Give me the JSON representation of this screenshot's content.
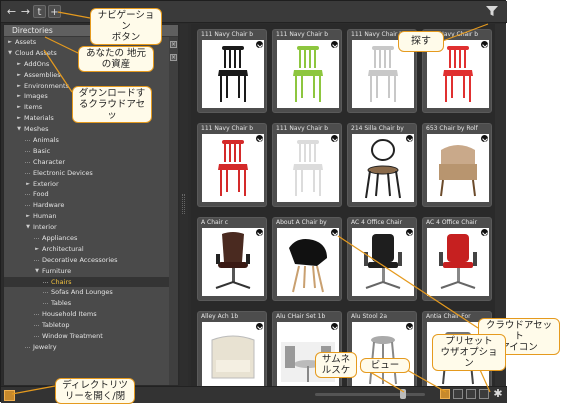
{
  "toolbar": {
    "buttons": [
      "←",
      "→",
      "t",
      "+"
    ]
  },
  "left_panel": {
    "header": "Directories",
    "tree": [
      {
        "label": "Assets",
        "depth": 0,
        "arrow": "►"
      },
      {
        "label": "Cloud Assets",
        "depth": 0,
        "arrow": "▼"
      },
      {
        "label": "AddOns",
        "depth": 1,
        "arrow": "►"
      },
      {
        "label": "Assemblies",
        "depth": 1,
        "arrow": "►"
      },
      {
        "label": "Environments",
        "depth": 1,
        "arrow": "►"
      },
      {
        "label": "Images",
        "depth": 1,
        "arrow": "►"
      },
      {
        "label": "Items",
        "depth": 1,
        "arrow": "►"
      },
      {
        "label": "Materials",
        "depth": 1,
        "arrow": "►"
      },
      {
        "label": "Meshes",
        "depth": 1,
        "arrow": "▼"
      },
      {
        "label": "Animals",
        "depth": 2,
        "arrow": ""
      },
      {
        "label": "Basic",
        "depth": 2,
        "arrow": ""
      },
      {
        "label": "Character",
        "depth": 2,
        "arrow": ""
      },
      {
        "label": "Electronic Devices",
        "depth": 2,
        "arrow": ""
      },
      {
        "label": "Exterior",
        "depth": 2,
        "arrow": "►"
      },
      {
        "label": "Food",
        "depth": 2,
        "arrow": ""
      },
      {
        "label": "Hardware",
        "depth": 2,
        "arrow": ""
      },
      {
        "label": "Human",
        "depth": 2,
        "arrow": "►"
      },
      {
        "label": "Interior",
        "depth": 2,
        "arrow": "▼"
      },
      {
        "label": "Appliances",
        "depth": 3,
        "arrow": ""
      },
      {
        "label": "Architectural",
        "depth": 3,
        "arrow": "►"
      },
      {
        "label": "Decorative Accessories",
        "depth": 3,
        "arrow": ""
      },
      {
        "label": "Furniture",
        "depth": 3,
        "arrow": "▼"
      },
      {
        "label": "Chairs",
        "depth": 4,
        "arrow": "",
        "selected": true
      },
      {
        "label": "Sofas And Lounges",
        "depth": 4,
        "arrow": ""
      },
      {
        "label": "Tables",
        "depth": 4,
        "arrow": ""
      },
      {
        "label": "Household Items",
        "depth": 3,
        "arrow": ""
      },
      {
        "label": "Tabletop",
        "depth": 3,
        "arrow": ""
      },
      {
        "label": "Window Treatment",
        "depth": 3,
        "arrow": ""
      },
      {
        "label": "Jewelry",
        "depth": 2,
        "arrow": ""
      }
    ]
  },
  "grid": {
    "cards": [
      {
        "title": "111 Navy Chair b",
        "chair": "navy",
        "color": "#1a1a1a"
      },
      {
        "title": "111 Navy Chair b",
        "chair": "navy",
        "color": "#8dc63f"
      },
      {
        "title": "111 Navy Chair b",
        "chair": "navy",
        "color": "#c8c8c8"
      },
      {
        "title": "111 Navy Chair b",
        "chair": "navy",
        "color": "#e03030"
      },
      {
        "title": "111 Navy Chair b",
        "chair": "navy",
        "color": "#d42a2a"
      },
      {
        "title": "111 Navy Chair b",
        "chair": "navy",
        "color": "#dcdcdc"
      },
      {
        "title": "214 Silla Chair by",
        "chair": "bentwood",
        "color": "#222"
      },
      {
        "title": "653 Chair by Rolf",
        "chair": "armchair",
        "color": "#c9a98a"
      },
      {
        "title": "A Chair c",
        "chair": "office-mesh",
        "color": "#4a2a20"
      },
      {
        "title": "About A Chair by",
        "chair": "shell",
        "color": "#111"
      },
      {
        "title": "AC 4 Office Chair",
        "chair": "office",
        "color": "#1e1e1e"
      },
      {
        "title": "AC 4 Office Chair",
        "chair": "office",
        "color": "#c62020"
      },
      {
        "title": "Alley Ach 1b",
        "chair": "lounge",
        "color": "#e8e2d2"
      },
      {
        "title": "Alu CHair Set 1b",
        "chair": "set",
        "color": "#bbb"
      },
      {
        "title": "Alu Stool 2a",
        "chair": "stool",
        "color": "#aaa"
      },
      {
        "title": "Antia Chair For",
        "chair": "modern",
        "color": "#777"
      }
    ]
  },
  "callouts": {
    "nav_buttons": "ナビゲーション\nボタン",
    "local_assets": "あなたの 地元\nの資産",
    "cloud_assets": "ダウンロードす\nるクラウドアセッ",
    "search": "探す",
    "cloud_icon": "クラウドアセット\nアイコン",
    "preset_options": "プリセット\nウザオプション",
    "thumbnail_scale": "サムネ\nルスケ",
    "view": "ビュー",
    "toggle_dir": "ディレクトリツ\nリーを開く/閉"
  },
  "colors": {
    "callout_border": "#e59a1e",
    "selection": "#f0c040",
    "accent": "#c7892c"
  }
}
